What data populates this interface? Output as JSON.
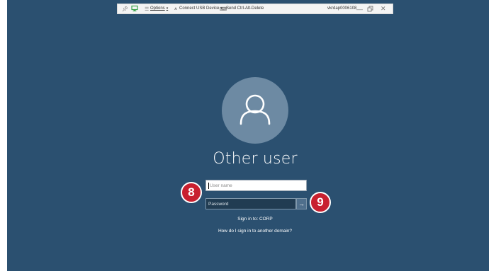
{
  "vm_toolbar": {
    "options_label": "Options",
    "usb_label": "Connect USB Device",
    "ctrl_alt_del_label": "Send Ctrl-Alt-Delete",
    "host_name": "vkrdap0006108",
    "dropdown_arrow": "▾"
  },
  "login": {
    "user_title": "Other user",
    "username_placeholder": "User name",
    "password_placeholder": "Password",
    "submit_glyph": "→",
    "sign_in_to": "Sign in to: CORP",
    "other_domain_link": "How do I sign in to another domain?"
  },
  "callouts": {
    "first": "8",
    "second": "9",
    "color": "#c8202f"
  },
  "colors": {
    "background": "#2b5070",
    "avatar": "#6d8aa3"
  }
}
